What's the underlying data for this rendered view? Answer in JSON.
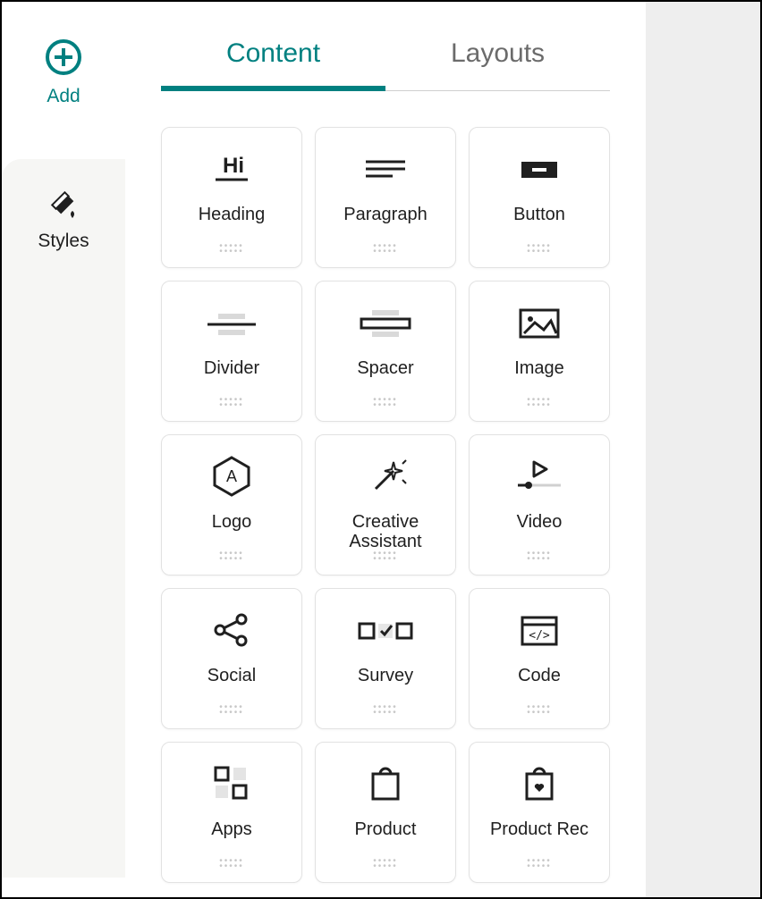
{
  "sidebar": {
    "add_label": "Add",
    "styles_label": "Styles"
  },
  "tabs": {
    "content": "Content",
    "layouts": "Layouts",
    "active": "content"
  },
  "blocks": [
    {
      "id": "heading",
      "label": "Heading"
    },
    {
      "id": "paragraph",
      "label": "Paragraph"
    },
    {
      "id": "button",
      "label": "Button"
    },
    {
      "id": "divider",
      "label": "Divider"
    },
    {
      "id": "spacer",
      "label": "Spacer"
    },
    {
      "id": "image",
      "label": "Image"
    },
    {
      "id": "logo",
      "label": "Logo"
    },
    {
      "id": "creative-assistant",
      "label": "Creative Assistant"
    },
    {
      "id": "video",
      "label": "Video"
    },
    {
      "id": "social",
      "label": "Social"
    },
    {
      "id": "survey",
      "label": "Survey"
    },
    {
      "id": "code",
      "label": "Code"
    },
    {
      "id": "apps",
      "label": "Apps"
    },
    {
      "id": "product",
      "label": "Product"
    },
    {
      "id": "product-rec",
      "label": "Product Rec"
    }
  ]
}
